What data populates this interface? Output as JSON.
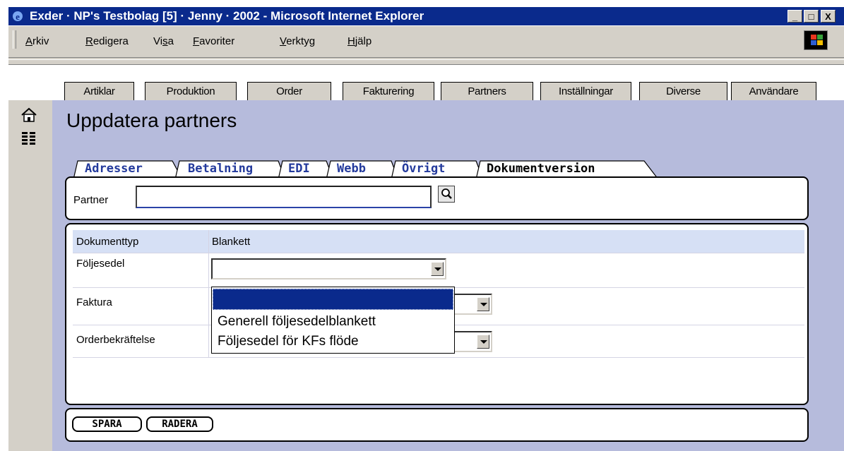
{
  "window": {
    "title": "Exder · NP's Testbolag [5] · Jenny · 2002 - Microsoft Internet Explorer",
    "controls": [
      "_",
      "□",
      "X"
    ]
  },
  "menu": {
    "items": [
      {
        "accel": "A",
        "rest": "rkiv"
      },
      {
        "accel": "R",
        "rest": "edigera"
      },
      {
        "pre": "Vi",
        "accel": "s",
        "rest": "a"
      },
      {
        "accel": "F",
        "rest": "avoriter"
      },
      {
        "accel": "V",
        "rest": "erktyg"
      },
      {
        "accel": "H",
        "rest": "jälp"
      }
    ]
  },
  "nav_tabs": [
    "Artiklar",
    "Produktion",
    "Order",
    "Fakturering",
    "Partners",
    "Inställningar",
    "Diverse",
    "Användare"
  ],
  "sidebar_icons": [
    "home-icon",
    "list-icon"
  ],
  "page_title": "Uppdatera partners",
  "sub_tabs": [
    "Adresser",
    "Betalning",
    "EDI",
    "Webb",
    "Övrigt",
    "Dokumentversion"
  ],
  "active_sub_tab": "Dokumentversion",
  "partner": {
    "label": "Partner",
    "value": ""
  },
  "doc_table": {
    "headers": [
      "Dokumenttyp",
      "Blankett"
    ],
    "rows": [
      {
        "type": "Följesedel",
        "value": ""
      },
      {
        "type": "Faktura",
        "value": ""
      },
      {
        "type": "Orderbekräftelse",
        "value": ""
      }
    ]
  },
  "dropdown_options": [
    "",
    "Generell följesedelblankett",
    "Följesedel för KFs flöde"
  ],
  "buttons": {
    "save": "SPARA",
    "delete": "RADERA"
  },
  "colors": {
    "titlebar": "#0a2a8c",
    "app_bg": "#b6bbdc",
    "tab_link": "#233a9c",
    "header_row": "#d6e0f5"
  }
}
